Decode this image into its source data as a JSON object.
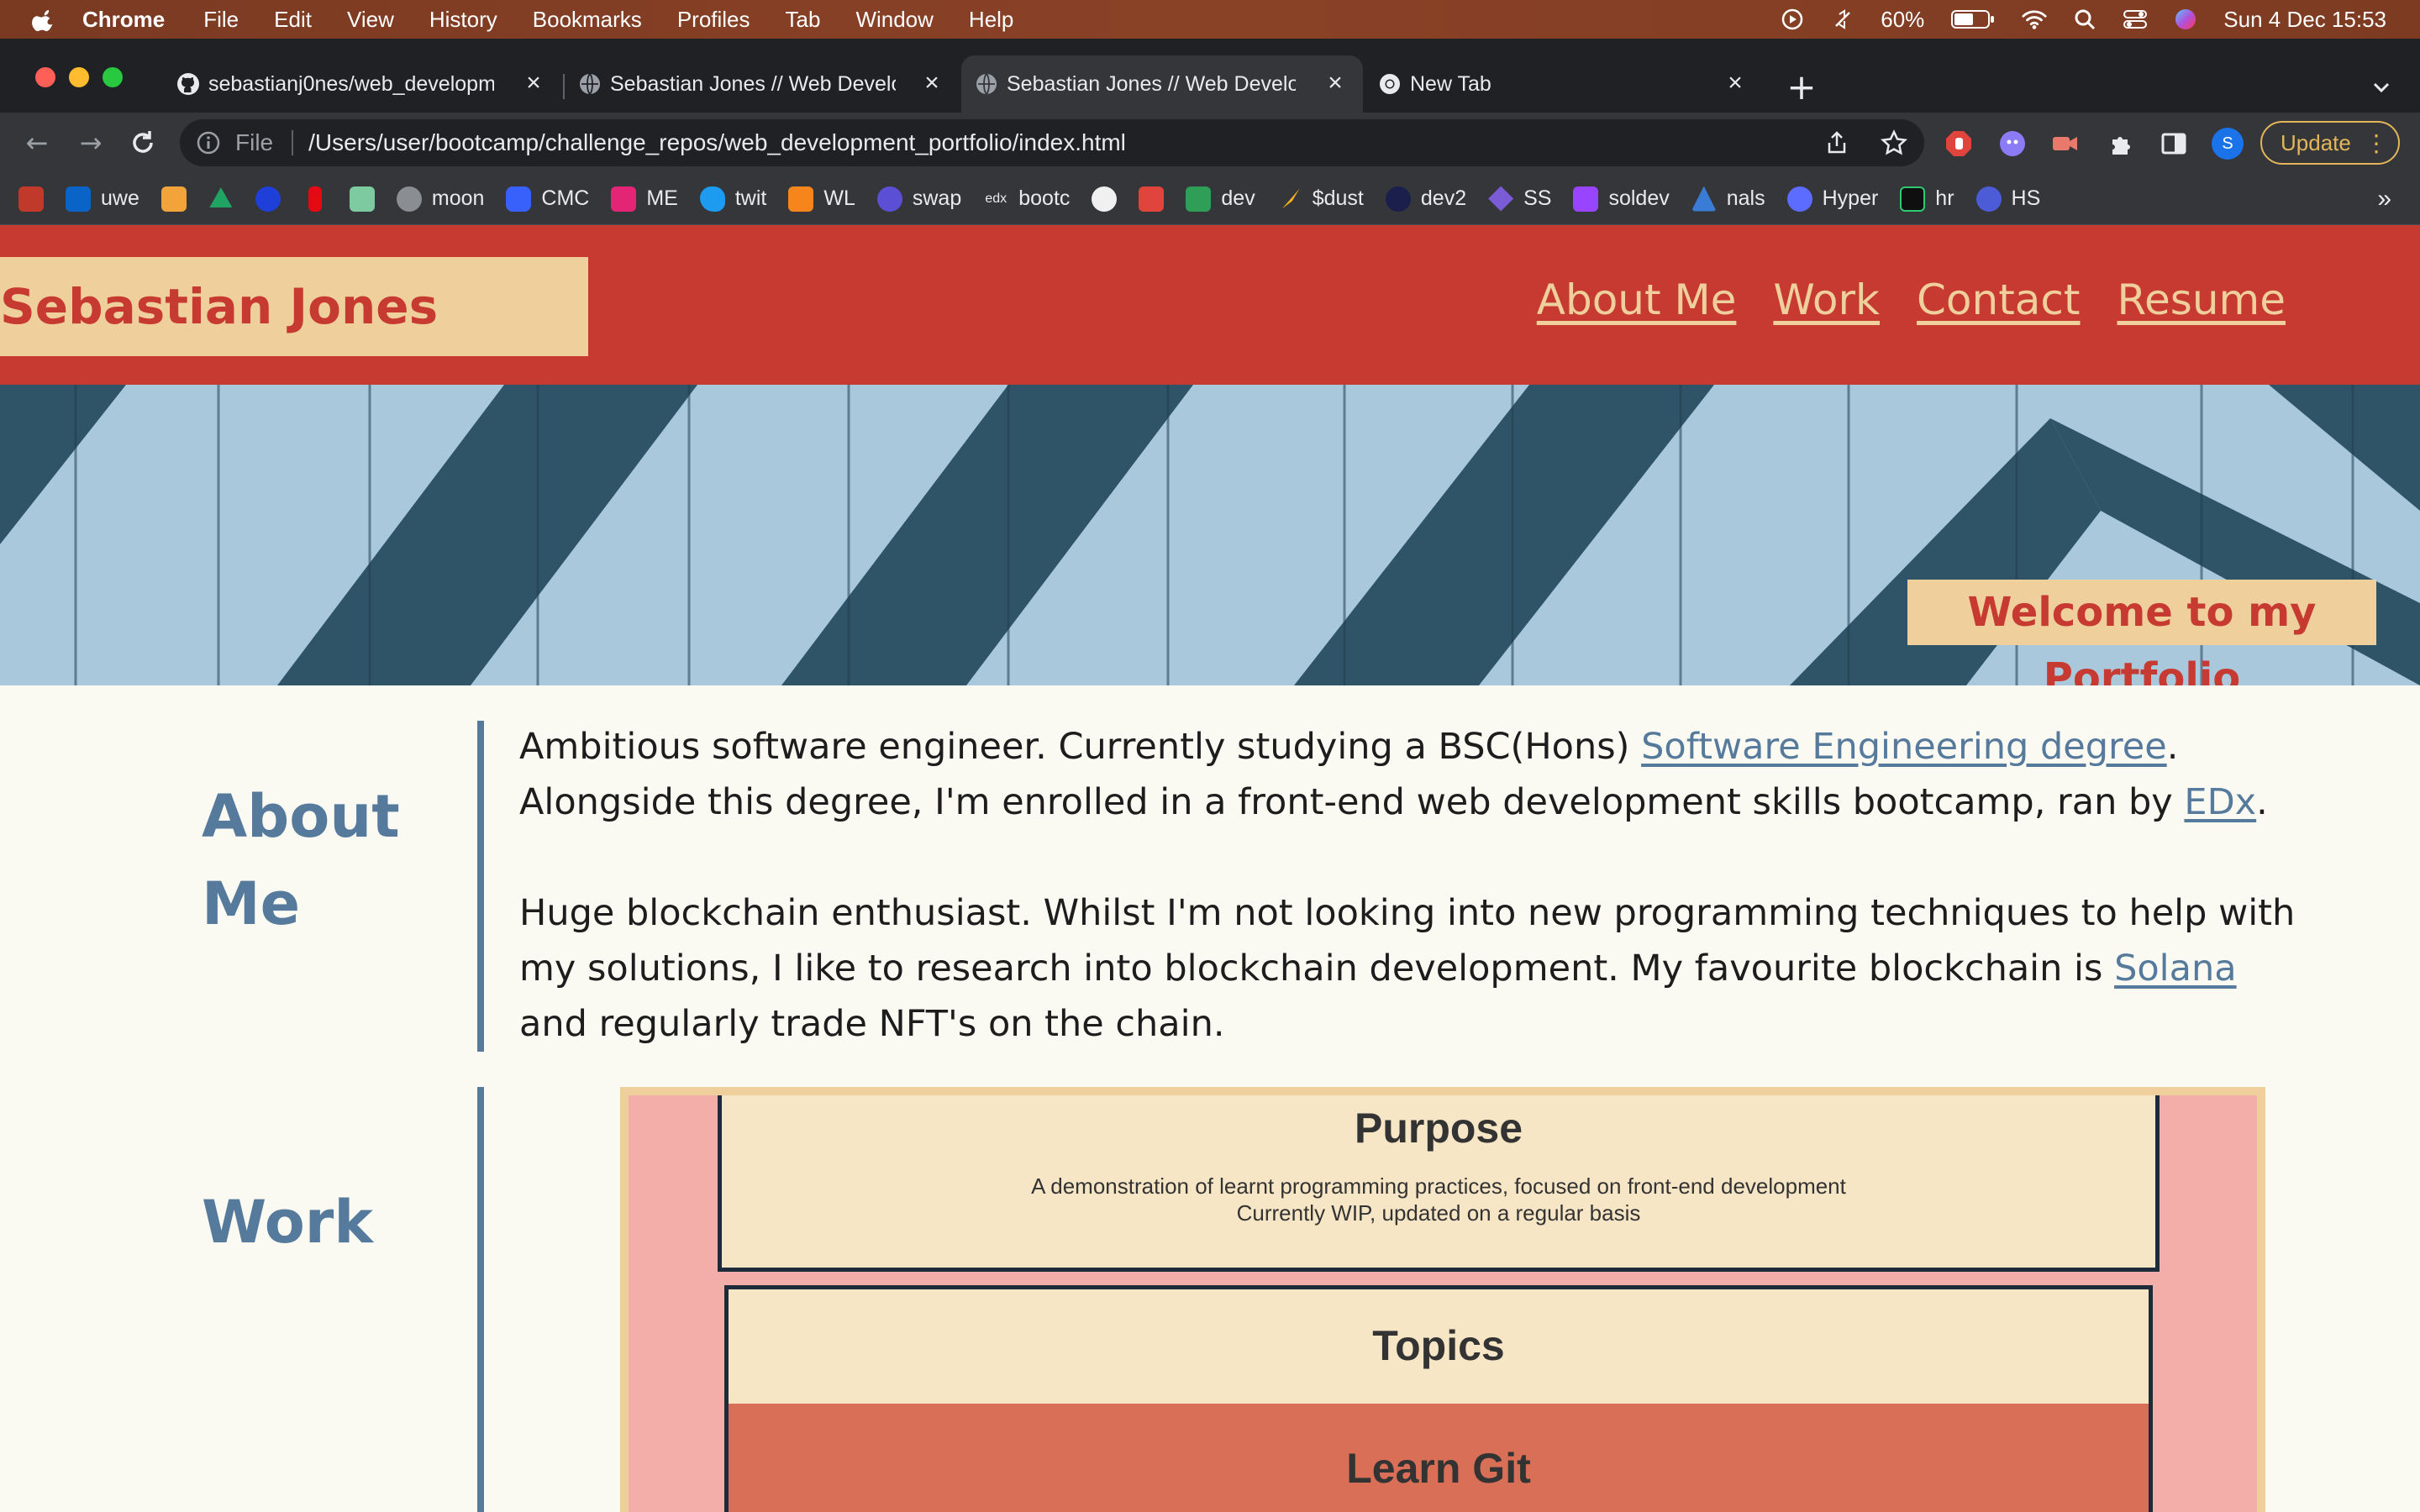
{
  "menubar": {
    "app_name": "Chrome",
    "menus": [
      "File",
      "Edit",
      "View",
      "History",
      "Bookmarks",
      "Profiles",
      "Tab",
      "Window",
      "Help"
    ],
    "battery": "60%",
    "datetime": "Sun 4 Dec  15:53"
  },
  "browser": {
    "tabs": [
      {
        "title": "sebastianj0nes/web_developm",
        "active": false
      },
      {
        "title": "Sebastian Jones // Web Develo",
        "active": false
      },
      {
        "title": "Sebastian Jones // Web Develo",
        "active": true
      },
      {
        "title": "New Tab",
        "active": false
      }
    ],
    "address": {
      "scheme_label": "File",
      "url": "/Users/user/bootcamp/challenge_repos/web_development_portfolio/index.html"
    },
    "update_label": "Update",
    "profile_initial": "S",
    "bookmarks": [
      {
        "label": "",
        "color": "#c0392b"
      },
      {
        "label": "uwe",
        "color": "#0a64c8"
      },
      {
        "label": "",
        "color": "#f2a33a"
      },
      {
        "label": "",
        "color": "#1fa463"
      },
      {
        "label": "",
        "color": "#1e40d8"
      },
      {
        "label": "",
        "color": "#e50914"
      },
      {
        "label": "",
        "color": "#7dc9a0"
      },
      {
        "label": "moon",
        "color": "#8a8d92"
      },
      {
        "label": "CMC",
        "color": "#3861fb"
      },
      {
        "label": "ME",
        "color": "#e42575"
      },
      {
        "label": "twit",
        "color": "#1d9bf0"
      },
      {
        "label": "WL",
        "color": "#f6851b"
      },
      {
        "label": "swap",
        "color": "#5b4fd6"
      },
      {
        "label": "bootc",
        "color": "#e8eaed"
      },
      {
        "label": "",
        "color": "#f0f0f0"
      },
      {
        "label": "",
        "color": "#e0443c"
      },
      {
        "label": "dev",
        "color": "#2f9e57"
      },
      {
        "label": "$dust",
        "color": "#f2b01e"
      },
      {
        "label": "dev2",
        "color": "#1b1f4b"
      },
      {
        "label": "SS",
        "color": "#7b5cd6"
      },
      {
        "label": "soldev",
        "color": "#9945ff"
      },
      {
        "label": "nals",
        "color": "#3a7bd5"
      },
      {
        "label": "Hyper",
        "color": "#5b6cff"
      },
      {
        "label": "hr",
        "color": "#0f0f0f"
      },
      {
        "label": "HS",
        "color": "#4b5cd6"
      }
    ]
  },
  "site": {
    "brand": "Sebastian Jones",
    "nav": [
      "About Me",
      "Work",
      "Contact",
      "Resume"
    ],
    "hero_badge": "Welcome to my Portfolio",
    "about": {
      "title_line1": "About",
      "title_line2": "Me",
      "p1_a": "Ambitious software engineer. Currently studying a BSC(Hons) ",
      "p1_link1": "Software Engineering degree",
      "p1_b": ". Alongside this degree, I'm enrolled in a front-end web development skills bootcamp, ran by ",
      "p1_link2": "EDx",
      "p1_c": ".",
      "p2_a": "Huge blockchain enthusiast. Whilst I'm not looking into new programming techniques to help with my solutions, I like to research into blockchain development. My favourite blockchain is ",
      "p2_link": "Solana",
      "p2_b": " and regularly trade NFT's on the chain."
    },
    "work": {
      "title": "Work",
      "purpose_title": "Purpose",
      "purpose_line1": "A demonstration of learnt programming practices, focused on front-end development",
      "purpose_line2": "Currently WIP, updated on a regular basis",
      "topics_title": "Topics",
      "topic_1": "Learn Git"
    }
  },
  "colors": {
    "header_red": "#c73a31",
    "brand_tan": "#efcf9c",
    "accent_blue": "#567a9c",
    "work_pink": "#f4aeaa",
    "card_cream": "#f7e6c6",
    "topic_orange": "#d96f56"
  }
}
